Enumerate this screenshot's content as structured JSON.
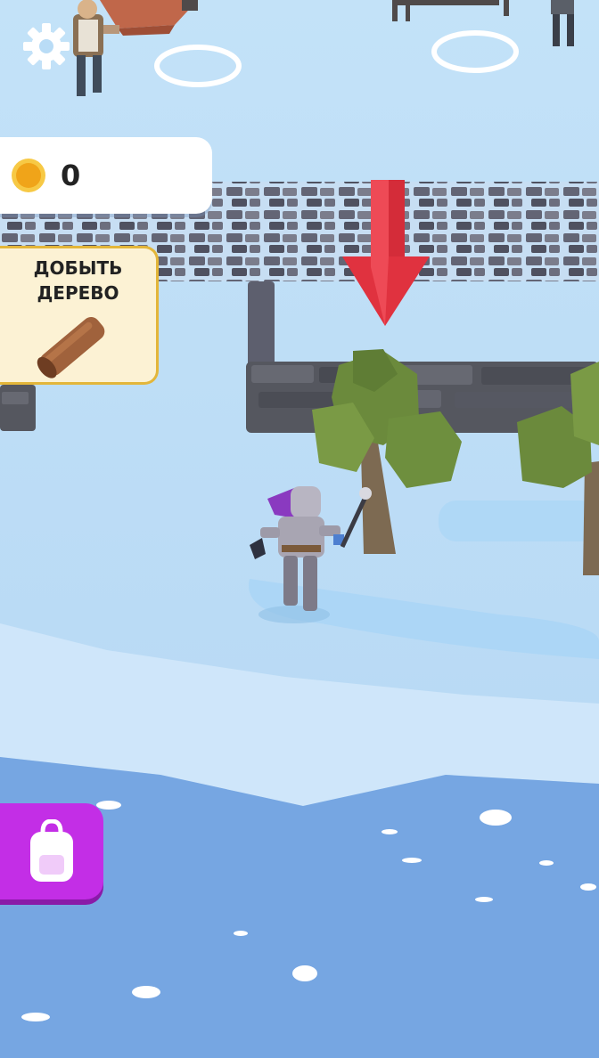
{
  "colors": {
    "ground": "#bfe0f7",
    "water": "#76a6e2",
    "stone": "#5d5f6e",
    "tree": "#6b8a3c",
    "arrow": "#e0323f",
    "coin": "#f5b21b",
    "quest_border": "#e3b63a",
    "backpack": "#c32ee6"
  },
  "hud": {
    "settings_icon": "gear-icon",
    "coins": {
      "icon": "coin-icon",
      "count": "0"
    },
    "quest": {
      "title": "ДОБЫТЬ\nДЕРЕВО",
      "icon": "log-icon"
    },
    "backpack_icon": "backpack-icon"
  }
}
